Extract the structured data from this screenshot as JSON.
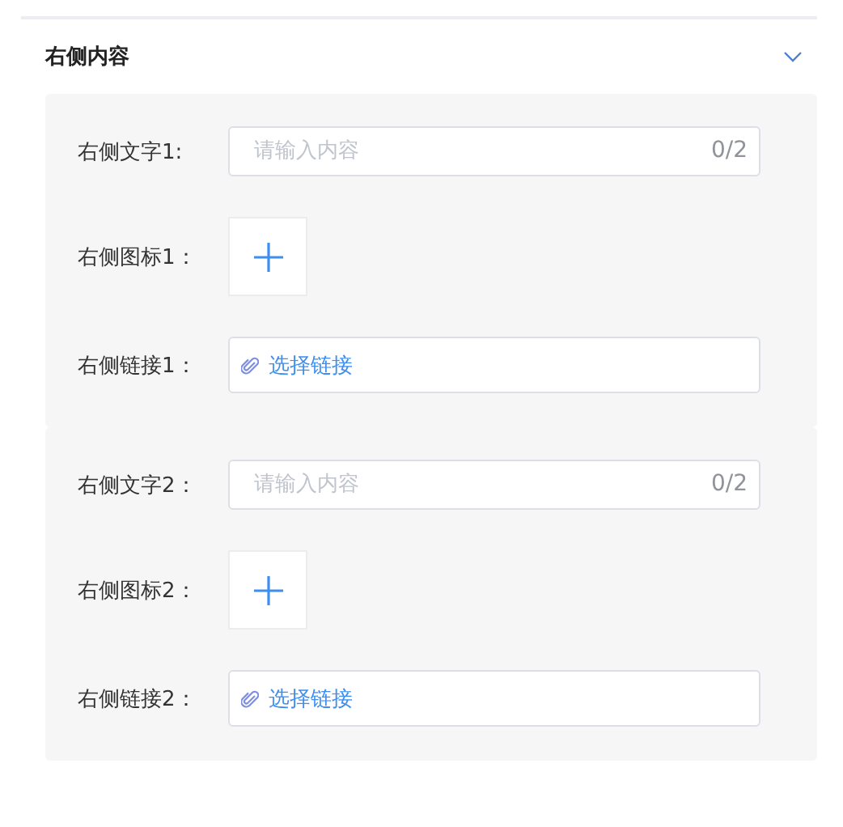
{
  "section": {
    "title": "右侧内容",
    "expanded": true,
    "groups": [
      {
        "rows": [
          {
            "kind": "text",
            "label": "右侧文字1:",
            "placeholder": "请输入内容",
            "counter": "0/2"
          },
          {
            "kind": "upload",
            "label": "右侧图标1："
          },
          {
            "kind": "link",
            "label": "右侧链接1：",
            "link_text": "选择链接"
          }
        ]
      },
      {
        "rows": [
          {
            "kind": "text",
            "label": "右侧文字2：",
            "placeholder": "请输入内容",
            "counter": "0/2"
          },
          {
            "kind": "upload",
            "label": "右侧图标2："
          },
          {
            "kind": "link",
            "label": "右侧链接2：",
            "link_text": "选择链接"
          }
        ]
      }
    ]
  }
}
